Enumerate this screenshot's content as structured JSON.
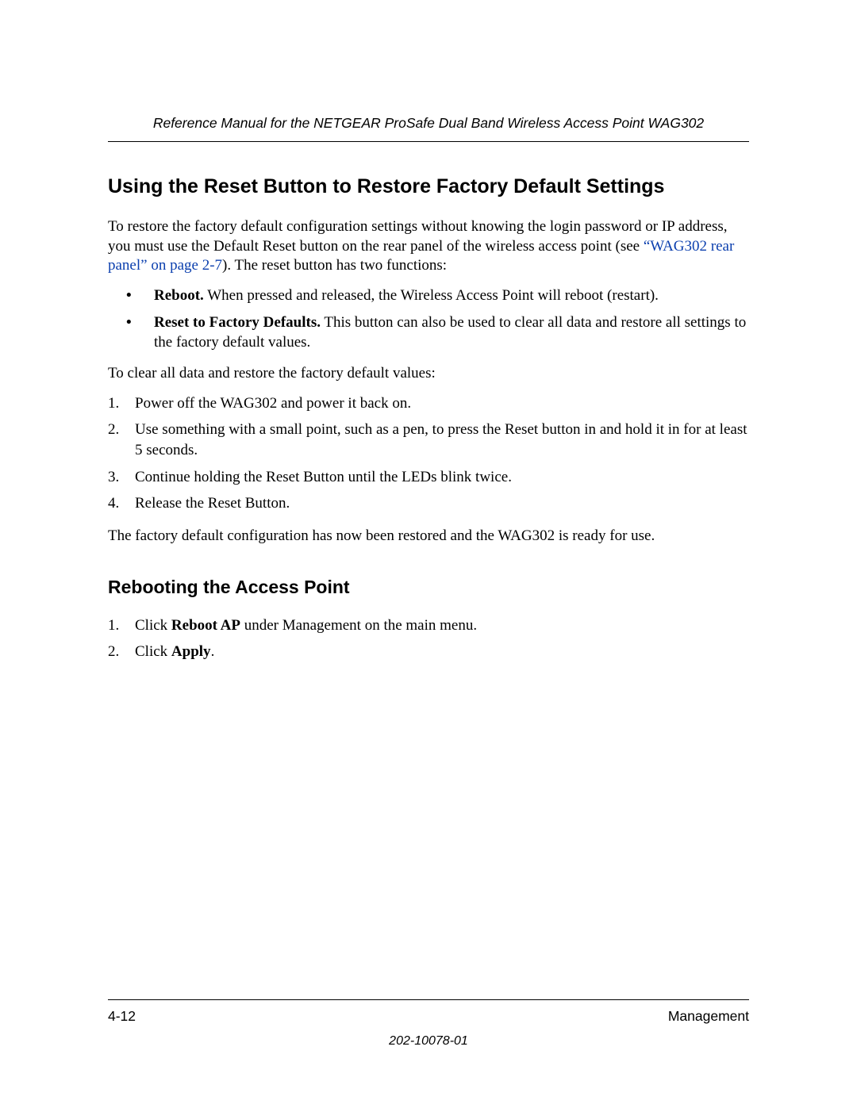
{
  "header": {
    "running": "Reference Manual for the NETGEAR ProSafe Dual Band Wireless Access Point WAG302"
  },
  "section1": {
    "heading": "Using the Reset Button to Restore Factory Default Settings",
    "intro_part1": "To restore the factory default configuration settings without knowing the login password or IP address, you must use the Default Reset button on the rear panel of the wireless access point (see ",
    "intro_link": "“WAG302 rear panel” on page 2-7",
    "intro_part2": "). The reset button has two functions:",
    "bullet1_label": "Reboot.",
    "bullet1_text": "  When pressed and released, the Wireless Access Point will reboot (restart).",
    "bullet2_label": "Reset to Factory Defaults.",
    "bullet2_text": "  This button can also be used to clear all data and restore all settings to the factory default values.",
    "clear_intro": "To clear all data and restore the factory default values:",
    "step1": "Power off the WAG302 and power it back on.",
    "step2": "Use something with a small point, such as a pen, to press the Reset button in and hold it in for at least 5 seconds.",
    "step3": "Continue holding the Reset Button until the LEDs blink twice.",
    "step4": "Release the Reset Button.",
    "conclusion": "The factory default configuration has now been restored and the WAG302 is ready for use."
  },
  "section2": {
    "heading": "Rebooting the Access Point",
    "step1_pre": "Click ",
    "step1_bold": "Reboot AP",
    "step1_post": " under Management on the main menu.",
    "step2_pre": "Click ",
    "step2_bold": "Apply",
    "step2_post": "."
  },
  "footer": {
    "page": "4-12",
    "section": "Management",
    "docnum": "202-10078-01"
  }
}
